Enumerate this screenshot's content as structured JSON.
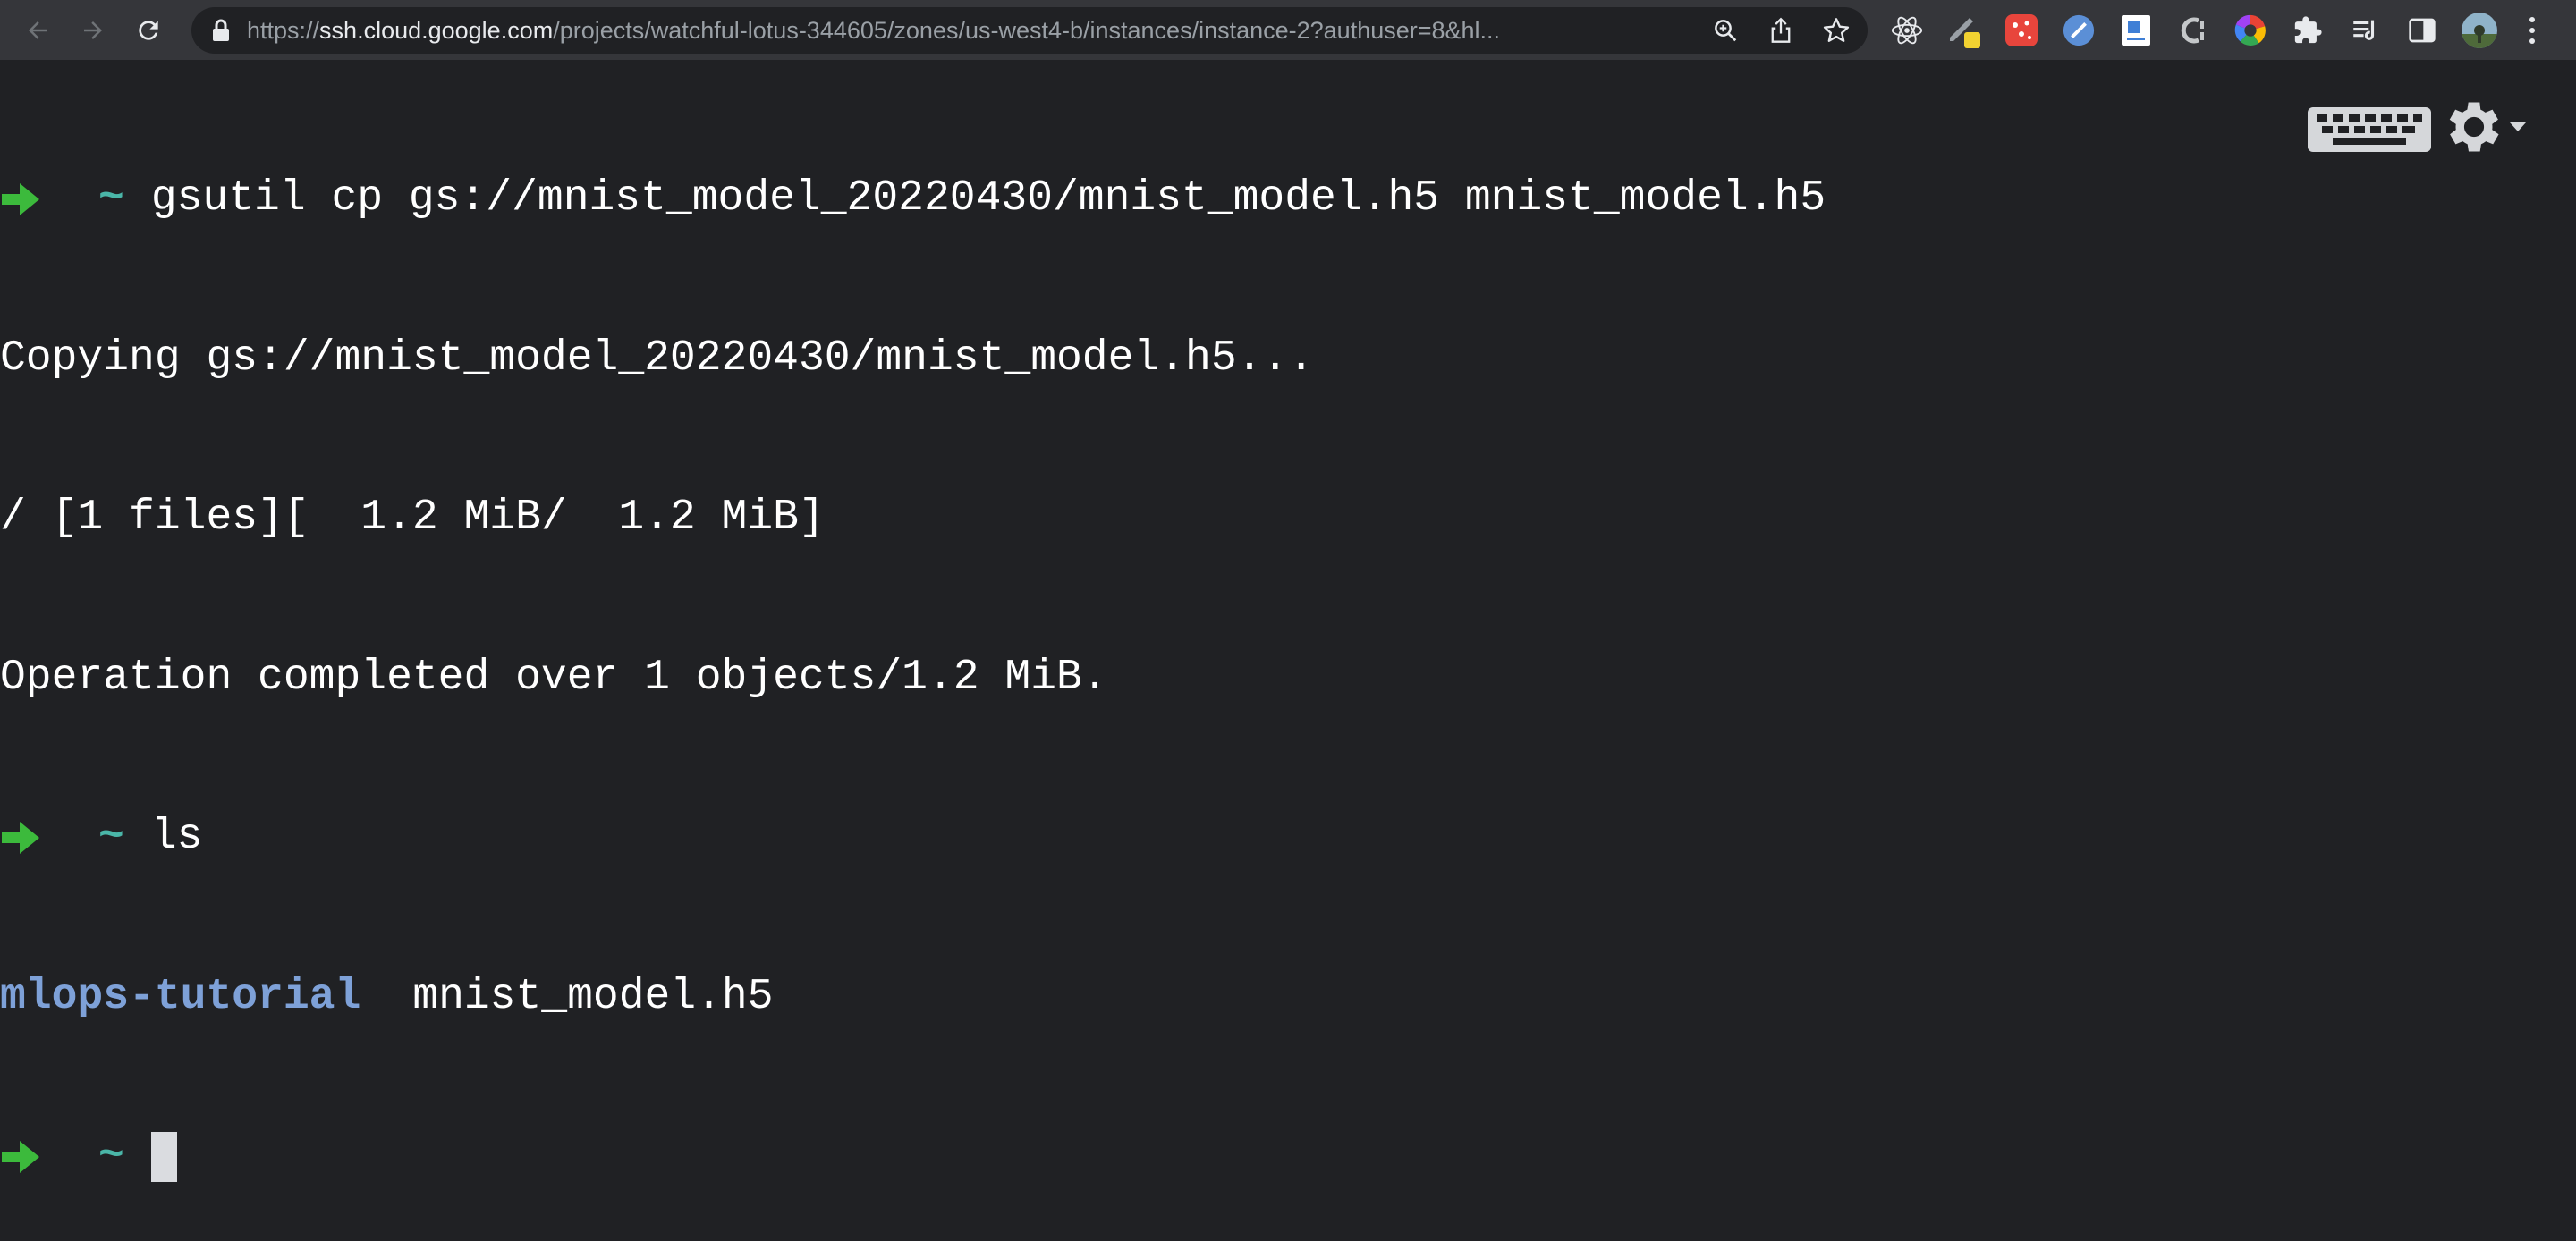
{
  "browser": {
    "url_host": "ssh.cloud.google.com",
    "url_path": "/projects/watchful-lotus-344605/zones/us-west4-b/instances/instance-2?authuser=8&hl...",
    "url_scheme": "https://",
    "icons": {
      "back": "back-arrow-icon",
      "forward": "forward-arrow-icon",
      "reload": "reload-icon",
      "lock": "lock-icon",
      "zoom": "zoom-icon",
      "share": "share-icon",
      "bookmark": "star-icon",
      "menu": "kebab-menu-icon"
    },
    "extensions": [
      "react-devtools-icon",
      "pencil-extension-icon",
      "red-extension-icon",
      "blue-extension-icon",
      "document-extension-icon",
      "c-extension-icon",
      "color-wheel-icon",
      "puzzle-icon",
      "reading-list-icon",
      "side-panel-icon",
      "profile-avatar"
    ]
  },
  "terminal": {
    "lines": [
      {
        "type": "prompt",
        "tilde": "~",
        "command": "gsutil cp gs://mnist_model_20220430/mnist_model.h5 mnist_model.h5"
      },
      {
        "type": "output",
        "text": "Copying gs://mnist_model_20220430/mnist_model.h5..."
      },
      {
        "type": "output",
        "text": "/ [1 files][  1.2 MiB/  1.2 MiB]"
      },
      {
        "type": "output",
        "text": "Operation completed over 1 objects/1.2 MiB."
      },
      {
        "type": "prompt",
        "tilde": "~",
        "command": "ls"
      },
      {
        "type": "listing",
        "dir": "mlops-tutorial",
        "file": "mnist_model.h5"
      },
      {
        "type": "prompt",
        "tilde": "~",
        "command": ""
      }
    ],
    "colors": {
      "background": "#202124",
      "prompt_arrow": "#3cba3c",
      "tilde": "#4ab6a8",
      "directory": "#7ea1d8",
      "text": "#ffffff"
    },
    "controls": {
      "keyboard": "keyboard-icon",
      "settings": "gear-icon"
    }
  }
}
